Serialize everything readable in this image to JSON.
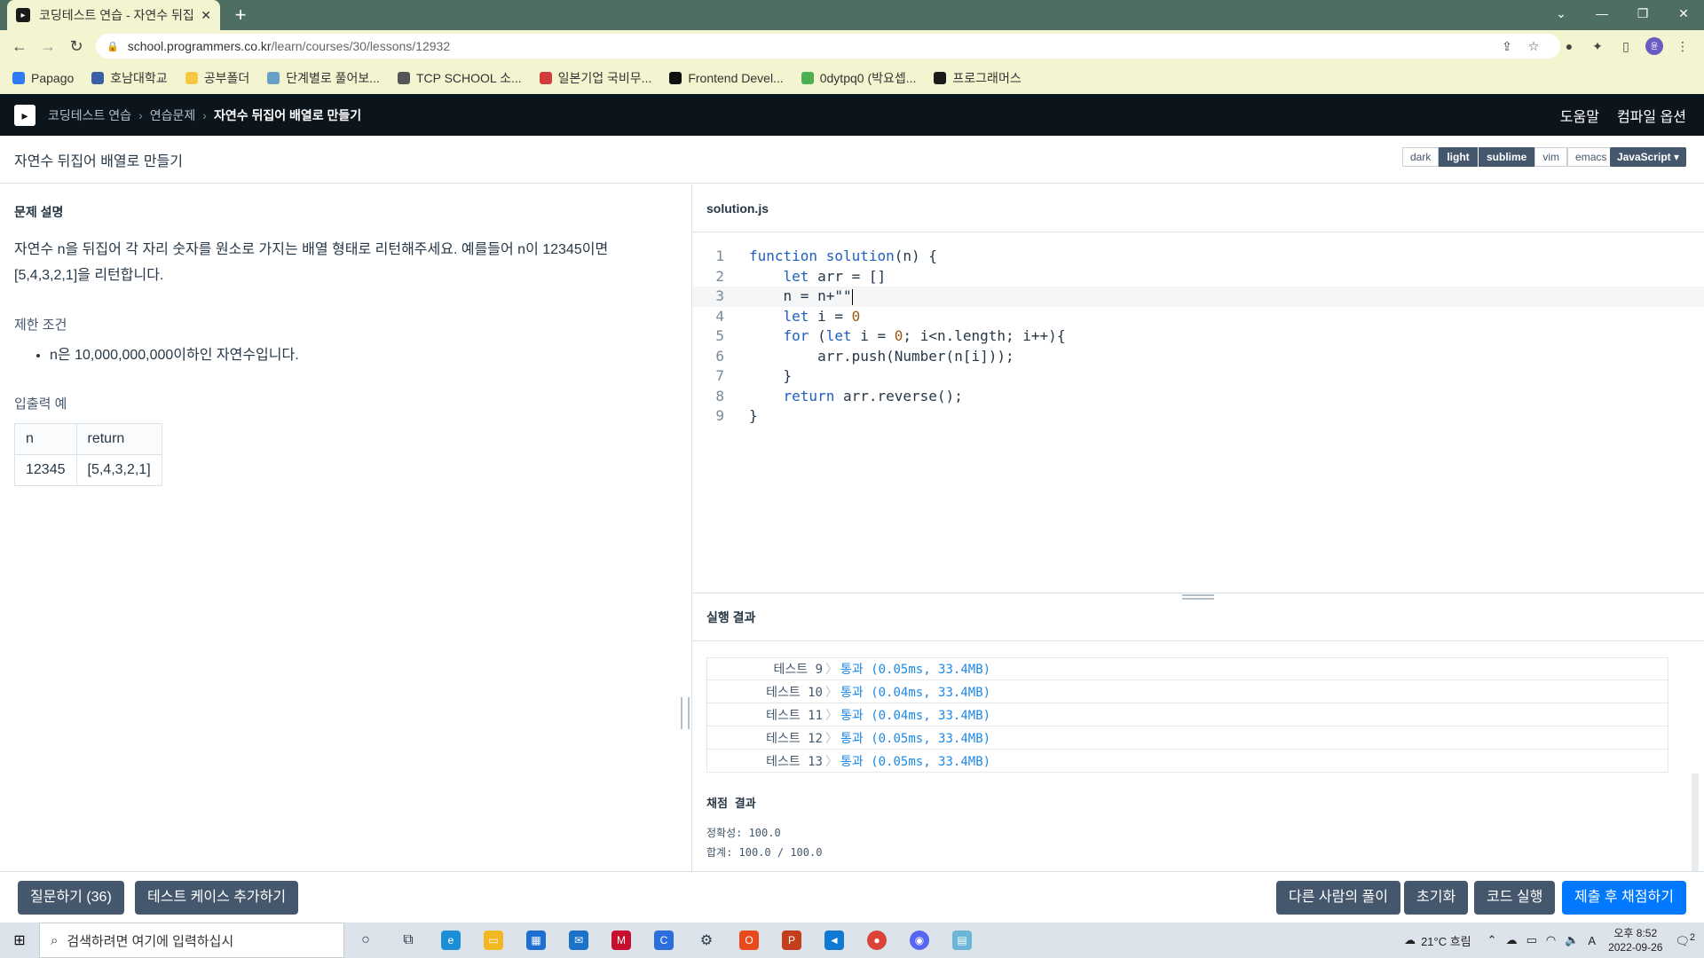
{
  "browser": {
    "tab_title": "코딩테스트 연습 - 자연수 뒤집",
    "url_host": "school.programmers.co.kr",
    "url_path": "/learn/courses/30/lessons/12932"
  },
  "bookmarks": [
    {
      "label": "Papago",
      "color": "#2d7cf6"
    },
    {
      "label": "호남대학교",
      "color": "#3a5ea8"
    },
    {
      "label": "공부폴더",
      "color": "#f5c842"
    },
    {
      "label": "단계별로 풀어보...",
      "color": "#6aa0c8"
    },
    {
      "label": "TCP SCHOOL 소...",
      "color": "#555555"
    },
    {
      "label": "일본기업 국비무...",
      "color": "#d33a3a"
    },
    {
      "label": "Frontend Devel...",
      "color": "#111111"
    },
    {
      "label": "0dytpq0 (박요셉...",
      "color": "#4caf50"
    },
    {
      "label": "프로그래머스",
      "color": "#1a1a1a"
    }
  ],
  "header": {
    "crumb1": "코딩테스트 연습",
    "crumb2": "연습문제",
    "crumb3": "자연수 뒤집어 배열로 만들기",
    "help": "도움말",
    "compile_options": "컴파일 옵션"
  },
  "title": {
    "text": "자연수 뒤집어 배열로 만들기",
    "theme_dark": "dark",
    "theme_light": "light",
    "key_sublime": "sublime",
    "key_vim": "vim",
    "key_emacs": "emacs",
    "language": "JavaScript"
  },
  "problem": {
    "heading": "문제 설명",
    "desc_line1": "자연수 n을 뒤집어 각 자리 숫자를 원소로 가지는 배열 형태로 리턴해주세요. 예를들어 n이 12345이면",
    "desc_line2": "[5,4,3,2,1]을 리턴합니다.",
    "constraint_heading": "제한 조건",
    "constraint": "n은 10,000,000,000이하인 자연수입니다.",
    "io_heading": "입출력 예",
    "table_headers": [
      "n",
      "return"
    ],
    "table_row": [
      "12345",
      "[5,4,3,2,1]"
    ]
  },
  "editor": {
    "filename": "solution.js",
    "line_numbers": [
      "1",
      "2",
      "3",
      "4",
      "5",
      "6",
      "7",
      "8",
      "9"
    ],
    "active_line": 3
  },
  "results": {
    "heading": "실행 결과",
    "rows": [
      {
        "label": "테스트 9",
        "status": "통과 (0.05ms, 33.4MB)"
      },
      {
        "label": "테스트 10",
        "status": "통과 (0.04ms, 33.4MB)"
      },
      {
        "label": "테스트 11",
        "status": "통과 (0.04ms, 33.4MB)"
      },
      {
        "label": "테스트 12",
        "status": "통과 (0.05ms, 33.4MB)"
      },
      {
        "label": "테스트 13",
        "status": "통과 (0.05ms, 33.4MB)"
      }
    ],
    "score_heading": "채점 결과",
    "accuracy": "정확성: 100.0",
    "total": "합계: 100.0 / 100.0"
  },
  "buttons": {
    "ask": "질문하기 (36)",
    "add_testcase": "테스트 케이스 추가하기",
    "others": "다른 사람의 풀이",
    "reset": "초기화",
    "run": "코드 실행",
    "submit": "제출 후 채점하기"
  },
  "taskbar": {
    "search_placeholder": "검색하려면 여기에 입력하십시",
    "weather": "21°C 흐림",
    "time": "오후 8:52",
    "date": "2022-09-26",
    "notif": "2"
  }
}
